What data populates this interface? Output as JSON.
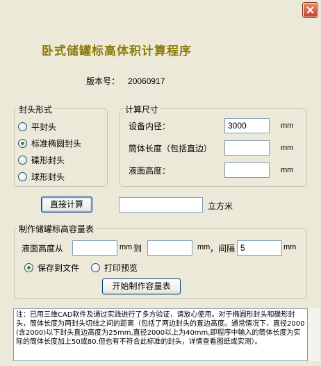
{
  "window": {
    "close_label": "✕"
  },
  "title": "卧式储罐标高体积计算程序",
  "version": {
    "label": "版本号：",
    "value": "20060917"
  },
  "head_type": {
    "group_label": "封头形式",
    "options": [
      {
        "label": "平封头",
        "selected": false
      },
      {
        "label": "标准椭圆封头",
        "selected": true
      },
      {
        "label": "碟形封头",
        "selected": false
      },
      {
        "label": "球形封头",
        "selected": false
      }
    ]
  },
  "dimensions": {
    "group_label": "计算尺寸",
    "inner_diameter_label": "设备内径：",
    "inner_diameter_value": "3000",
    "shell_length_label": "筒体长度（包括直边）",
    "shell_length_value": "",
    "liquid_height_label": "液面高度：",
    "liquid_height_value": "",
    "unit": "mm"
  },
  "calc": {
    "button_label": "直接计算",
    "result_value": "",
    "result_unit": "立方米"
  },
  "table": {
    "group_label": "制作储罐标高容量表",
    "from_label": "液面高度从",
    "from_value": "",
    "unit": "mm",
    "to_label": "到",
    "to_value": "",
    "interval_label": "，间隔",
    "interval_value": "5",
    "output_options": [
      {
        "label": "保存到文件",
        "selected": true
      },
      {
        "label": "打印预览",
        "selected": false
      }
    ],
    "start_button_label": "开始制作容量表"
  },
  "note": "注：已用三维CAD软件及通过实践进行了多方验证，请放心使用。对于椭圆形封头和碟形封头，筒体长度为两封头切线之间的距离（包括了两边封头的直边高度。通常情况下，直径2000(含2000)以下封头直边高度为25mm,直径2000以上为40mm,即程序中输入的筒体长度为实际的筒体长度加上50或80.但也有不符合此标准的封头，详情查看图纸或实测）。"
}
